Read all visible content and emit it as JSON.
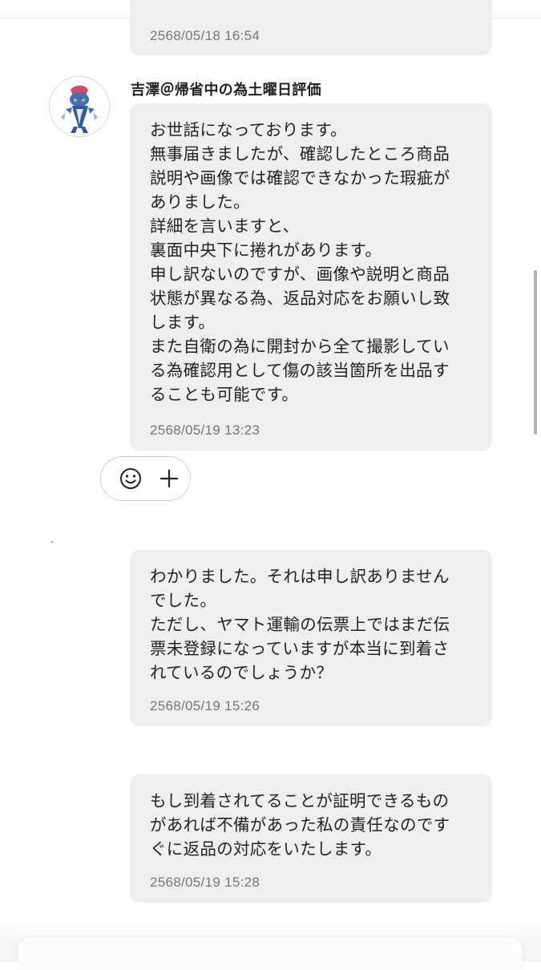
{
  "thread": {
    "messages": [
      {
        "id": "m0",
        "lines": [],
        "timestamp": "2568/05/18 16:54"
      },
      {
        "id": "m1",
        "sender": "吉澤＠帰省中の為土曜日評価",
        "avatar_icon": "character-avatar-icon",
        "lines": [
          "お世話になっております。",
          "無事届きましたが、確認したところ商品",
          "説明や画像では確認できなかった瑕疵が",
          "ありました。",
          "詳細を言いますと、",
          "裏面中央下に捲れがあります。",
          "申し訳ないのですが、画像や説明と商品",
          "状態が異なる為、返品対応をお願いし致",
          "します。",
          "また自衛の為に開封から全て撮影してい",
          "る為確認用として傷の該当箇所を出品す",
          "ることも可能です。"
        ],
        "timestamp": "2568/05/19 13:23"
      },
      {
        "id": "m2",
        "lines": [
          "わかりました。それは申し訳ありません",
          "でした。",
          "ただし、ヤマト運輸の伝票上ではまだ伝",
          "票未登録になっていますが本当に到着さ",
          "れているのでしょうか？"
        ],
        "timestamp": "2568/05/19 15:26"
      },
      {
        "id": "m3",
        "lines": [
          "もし到着されてることが証明できるもの",
          "があれば不備があった私の責任なのです",
          "ぐに返品の対応をいたします。"
        ],
        "timestamp": "2568/05/19 15:28"
      }
    ],
    "reactions": {
      "emoji_icon": "smiley-face-icon",
      "add_icon": "plus-icon"
    }
  },
  "colors": {
    "bubble": "#efefef",
    "timestamp": "#767676",
    "text": "#222222",
    "scrollbar": "#b3b3b3"
  }
}
